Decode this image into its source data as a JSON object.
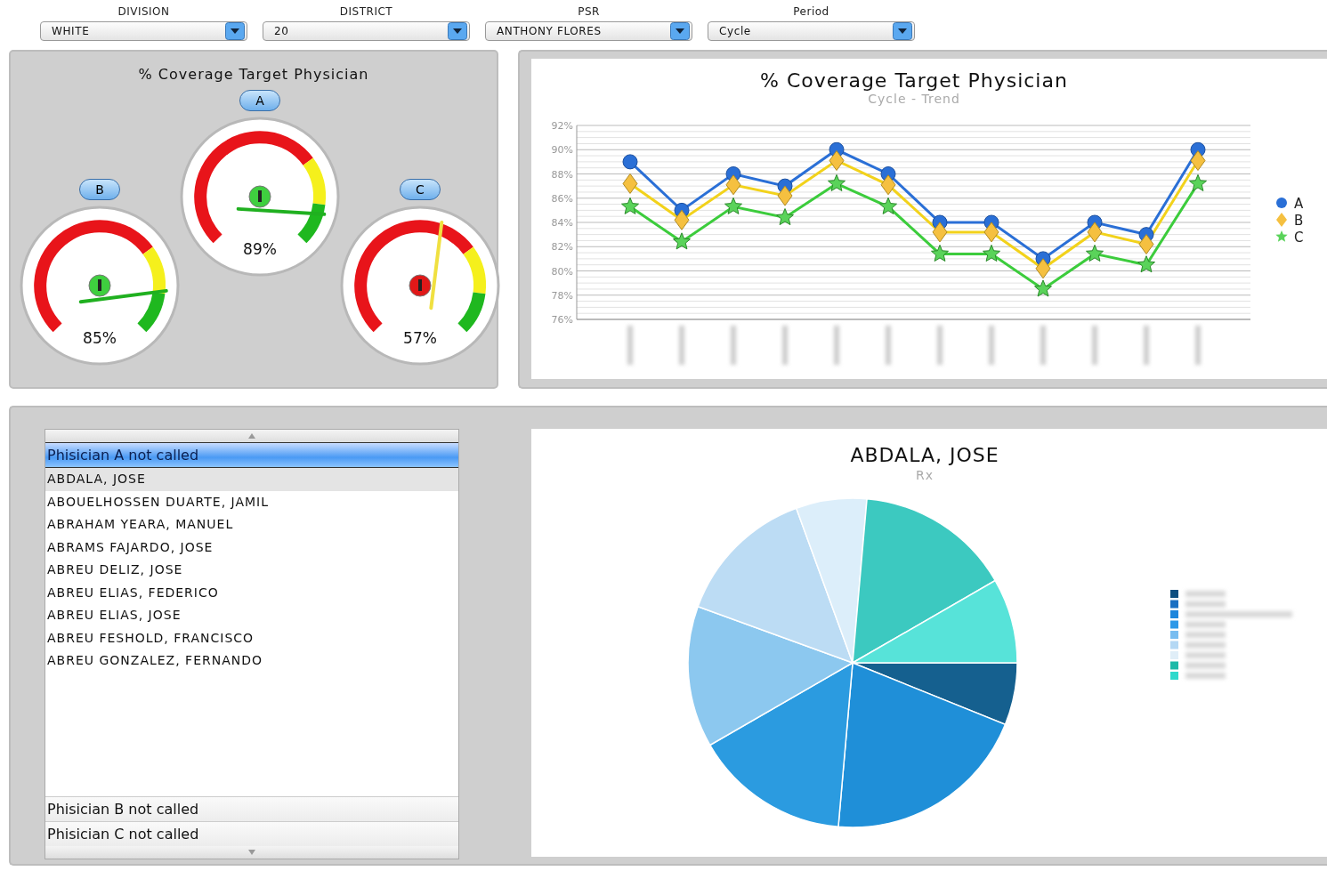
{
  "filters": [
    {
      "label": "DIVISION",
      "value": "WHITE"
    },
    {
      "label": "DISTRICT",
      "value": "20"
    },
    {
      "label": "PSR",
      "value": "ANTHONY FLORES"
    },
    {
      "label": "Period",
      "value": "Cycle"
    }
  ],
  "gauge_panel": {
    "title": "% Coverage Target Physician",
    "gauges": [
      {
        "label": "B",
        "reading": "85%"
      },
      {
        "label": "A",
        "reading": "89%"
      },
      {
        "label": "C",
        "reading": "57%"
      }
    ]
  },
  "trend_panel": {
    "chart_data": {
      "type": "line",
      "title": "% Coverage Target Physician",
      "subtitle": "Cycle - Trend",
      "grid": true,
      "legend": true,
      "ylim": [
        76,
        92
      ],
      "yticks": [
        {
          "value": 76,
          "label": "76%"
        },
        {
          "value": 78,
          "label": "78%"
        },
        {
          "value": 80,
          "label": "80%"
        },
        {
          "value": 82,
          "label": "82%"
        },
        {
          "value": 84,
          "label": "84%"
        },
        {
          "value": 86,
          "label": "86%"
        },
        {
          "value": 88,
          "label": "88%"
        },
        {
          "value": 90,
          "label": "90%"
        },
        {
          "value": 92,
          "label": "92%"
        }
      ],
      "series": [
        {
          "name": "A",
          "color": "#2a6fd6",
          "marker": "circle",
          "values": [
            89,
            85,
            88,
            87,
            90,
            88,
            84,
            84,
            81,
            84,
            83,
            90
          ]
        },
        {
          "name": "B",
          "color": "#f2d21b",
          "marker": "diamond",
          "values": [
            87.2,
            84.2,
            87.1,
            86.2,
            89.1,
            87.1,
            83.2,
            83.2,
            80.2,
            83.2,
            82.2,
            89.1
          ]
        },
        {
          "name": "C",
          "color": "#3ccc3c",
          "marker": "star",
          "values": [
            85.3,
            82.4,
            85.3,
            84.4,
            87.2,
            85.3,
            81.4,
            81.4,
            78.5,
            81.4,
            80.5,
            87.2
          ]
        }
      ]
    }
  },
  "physician_list": {
    "sections": [
      {
        "title": "Phisician A not called",
        "expanded": true,
        "selected": true,
        "items": [
          {
            "name": "ABDALA, JOSE",
            "selected": true
          },
          {
            "name": "ABOUELHOSSEN DUARTE, JAMIL",
            "selected": false
          },
          {
            "name": "ABRAHAM YEARA, MANUEL",
            "selected": false
          },
          {
            "name": "ABRAMS FAJARDO, JOSE",
            "selected": false
          },
          {
            "name": "ABREU DELIZ, JOSE",
            "selected": false
          },
          {
            "name": "ABREU ELIAS, FEDERICO",
            "selected": false
          },
          {
            "name": "ABREU ELIAS, JOSE",
            "selected": false
          },
          {
            "name": "ABREU FESHOLD, FRANCISCO",
            "selected": false
          },
          {
            "name": "ABREU GONZALEZ, FERNANDO",
            "selected": false
          }
        ]
      },
      {
        "title": "Phisician B not called",
        "expanded": false,
        "selected": false
      },
      {
        "title": "Phisician C not called",
        "expanded": false,
        "selected": false
      }
    ]
  },
  "pie_panel": {
    "title": "ABDALA, JOSE",
    "subtitle": "Rx"
  }
}
